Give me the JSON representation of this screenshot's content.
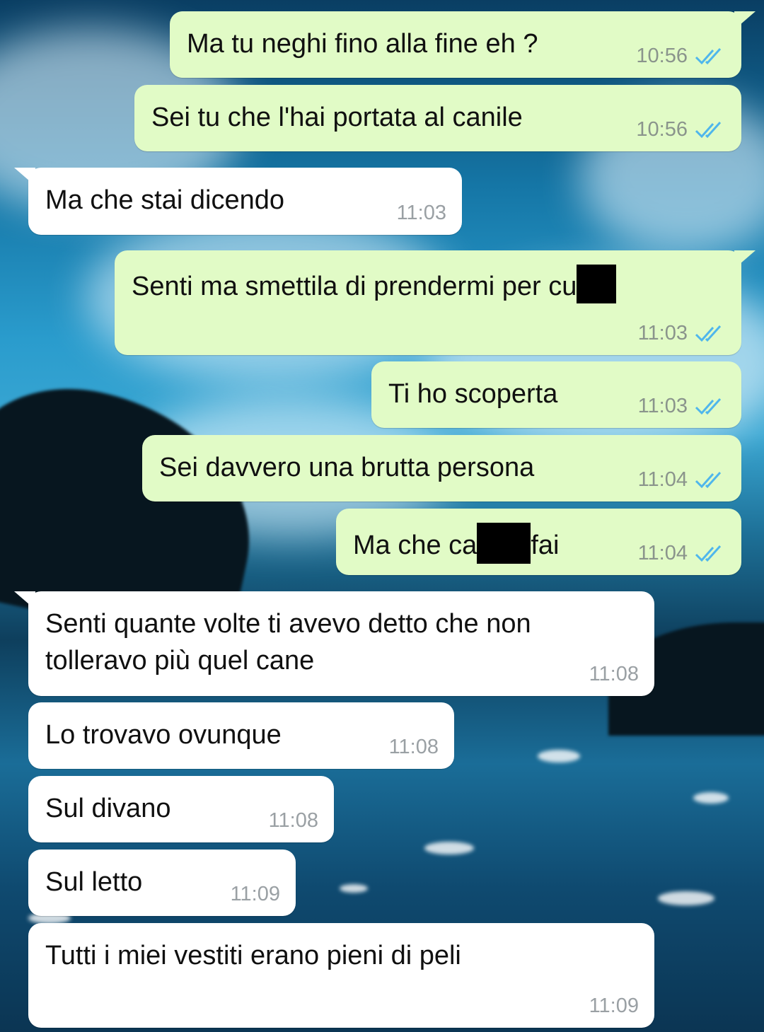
{
  "colors": {
    "outgoing_bubble": "#e1fbc6",
    "incoming_bubble": "#ffffff",
    "read_ticks": "#4fb6ec",
    "time_text": "#8a948c"
  },
  "messages": [
    {
      "direction": "outgoing",
      "text": "Ma tu neghi fino alla fine eh ?",
      "time": "10:56",
      "status": "read"
    },
    {
      "direction": "outgoing",
      "text": "Sei tu che l'hai portata al canile",
      "time": "10:56",
      "status": "read"
    },
    {
      "direction": "incoming",
      "text": "Ma che stai dicendo",
      "time": "11:03"
    },
    {
      "direction": "outgoing",
      "text_before_redaction": "Senti ma smettila di prendermi per cu",
      "time": "11:03",
      "status": "read"
    },
    {
      "direction": "outgoing",
      "text": "Ti ho scoperta",
      "time": "11:03",
      "status": "read"
    },
    {
      "direction": "outgoing",
      "text": "Sei davvero una brutta persona",
      "time": "11:04",
      "status": "read"
    },
    {
      "direction": "outgoing",
      "text_before_redaction": "Ma che ca",
      "text_after_redaction": "fai",
      "time": "11:04",
      "status": "read"
    },
    {
      "direction": "incoming",
      "text": "Senti quante volte ti avevo detto che non\ntolleravo più quel cane",
      "time": "11:08"
    },
    {
      "direction": "incoming",
      "text": "Lo trovavo ovunque",
      "time": "11:08"
    },
    {
      "direction": "incoming",
      "text": "Sul divano",
      "time": "11:08"
    },
    {
      "direction": "incoming",
      "text": "Sul letto",
      "time": "11:09"
    },
    {
      "direction": "incoming",
      "text": "Tutti i miei vestiti erano pieni di peli",
      "time": "11:09"
    }
  ]
}
